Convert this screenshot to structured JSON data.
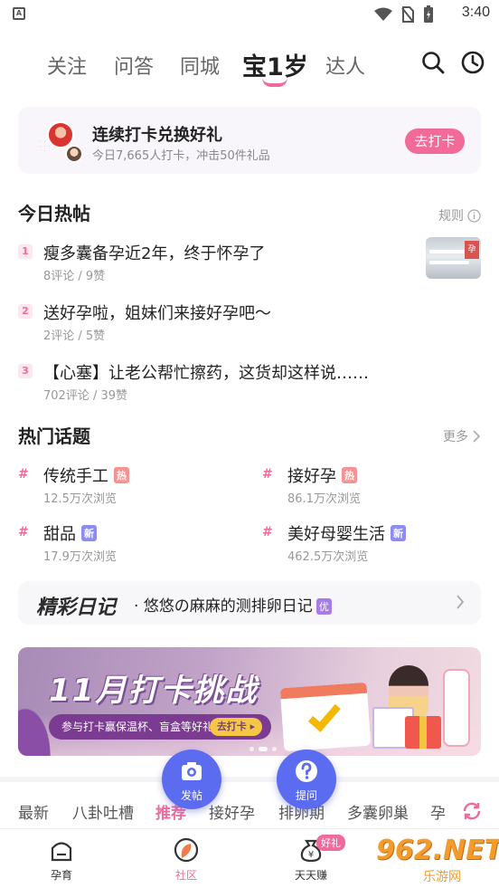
{
  "status": {
    "time": "3:40"
  },
  "nav": {
    "tabs": [
      "关注",
      "问答",
      "同城",
      "宝1岁",
      "达人"
    ],
    "active": "宝1岁"
  },
  "checkin": {
    "title": "连续打卡兑换好礼",
    "subtitle": "今日7,665人打卡，冲击50件礼品",
    "button": "去打卡"
  },
  "hot_posts": {
    "title": "今日热帖",
    "rules": "规则",
    "items": [
      {
        "rank": "1",
        "title": "瘦多囊备孕近2年，终于怀孕了",
        "meta": "8评论 / 9赞"
      },
      {
        "rank": "2",
        "title": "送好孕啦，姐妹们来接好孕吧～",
        "meta": "2评论 / 5赞"
      },
      {
        "rank": "3",
        "title": "【心塞】让老公帮忙擦药，这货却这样说……",
        "meta": "702评论 / 39赞"
      }
    ]
  },
  "topics": {
    "title": "热门话题",
    "more": "更多",
    "items": [
      {
        "name": "传统手工",
        "badge": "热",
        "views": "12.5万次浏览"
      },
      {
        "name": "接好孕",
        "badge": "热",
        "views": "86.1万次浏览"
      },
      {
        "name": "甜品",
        "badge": "新",
        "views": "17.9万次浏览"
      },
      {
        "name": "美好母婴生活",
        "badge": "新",
        "views": "462.5万次浏览"
      }
    ]
  },
  "diary": {
    "logo": "精彩日记",
    "text": "· 悠悠の麻麻的测排卵日记",
    "badge": "优"
  },
  "banner": {
    "heading": "11月打卡挑战",
    "pill": "参与打卡赢保温杯、盲盒等好礼!",
    "pill_button": "去打卡 ▸"
  },
  "categories": {
    "items": [
      "最新",
      "八卦吐槽",
      "推荐",
      "接好孕",
      "排卵期",
      "多囊卵巢",
      "孕"
    ],
    "active": "推荐"
  },
  "fabs": {
    "post": "发帖",
    "ask": "提问"
  },
  "bottom": {
    "items": [
      "孕育",
      "社区",
      "天天赚"
    ],
    "active": "社区",
    "gift_badge": "好礼"
  },
  "watermark": {
    "big": "962.NET",
    "small": "乐游网"
  },
  "colors": {
    "accent": "#f06a9e",
    "fab": "#5c6cf0"
  }
}
